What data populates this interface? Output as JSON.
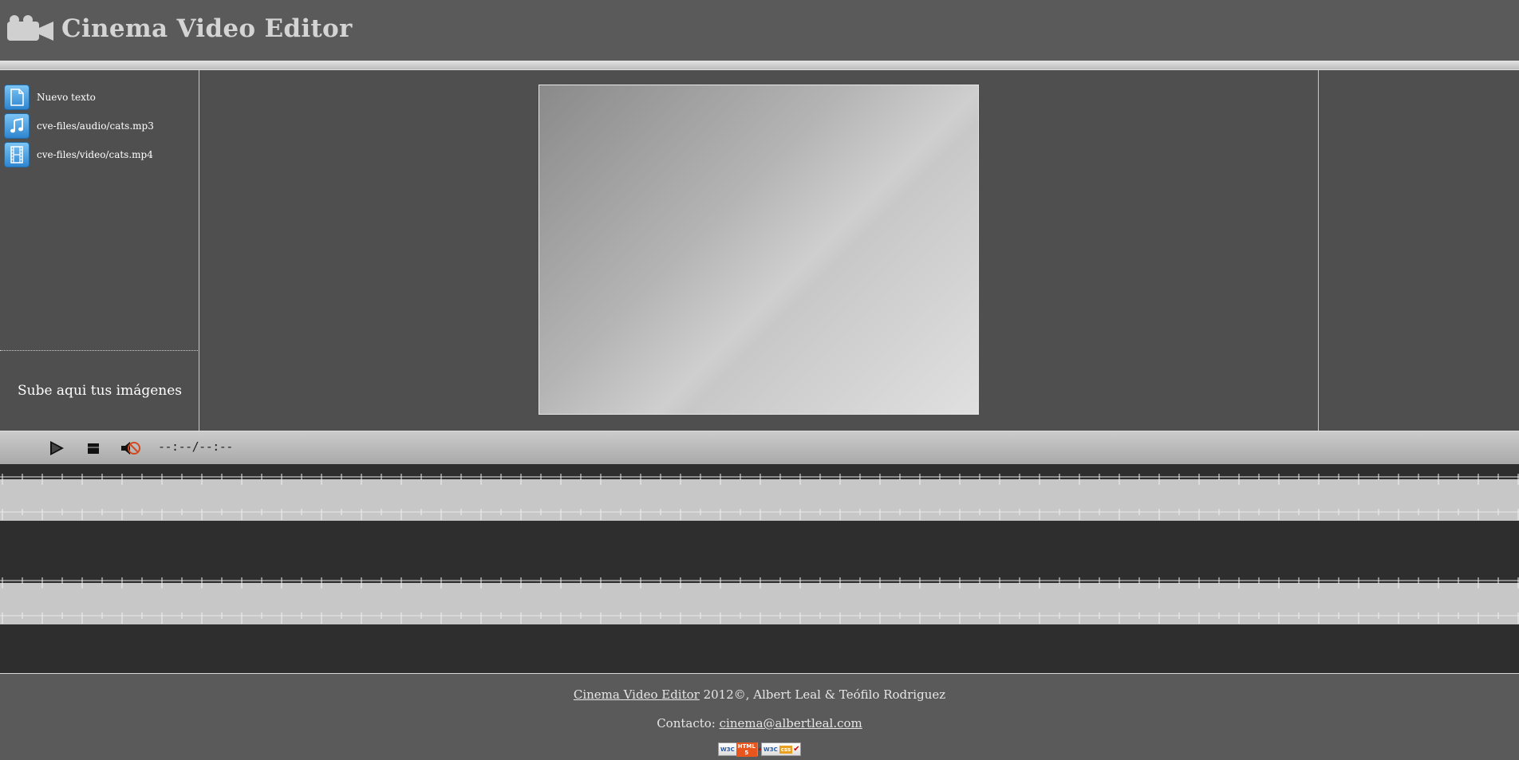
{
  "header": {
    "title": "Cinema Video Editor",
    "logo_icon": "video-camera-icon"
  },
  "sidebar": {
    "items": [
      {
        "label": "Nuevo texto",
        "icon": "document-icon"
      },
      {
        "label": "cve-files/audio/cats.mp3",
        "icon": "music-note-icon"
      },
      {
        "label": "cve-files/video/cats.mp4",
        "icon": "film-icon"
      }
    ],
    "upload_label": "Sube aqui tus imágenes"
  },
  "controls": {
    "play_icon": "play-icon",
    "stop_icon": "stop-icon",
    "mute_icon": "mute-icon",
    "time": "--:--/--:--"
  },
  "footer": {
    "link_text": "Cinema Video Editor",
    "copyright": " 2012©, Albert Leal & Teófilo Rodriguez",
    "contact_label": "Contacto: ",
    "contact_email": "cinema@albertleal.com",
    "badges": [
      {
        "w3c": "W3C",
        "kind": "HTML 5",
        "color": "#e8561e"
      },
      {
        "w3c": "W3C",
        "kind": "css",
        "color": "#e8a01e"
      }
    ]
  },
  "colors": {
    "background": "#5a5a5a",
    "workspace": "#4f4f4f",
    "timeline": "#2e2e2e",
    "track": "#c7c7c7",
    "icon_blue": "#2e86d0"
  }
}
